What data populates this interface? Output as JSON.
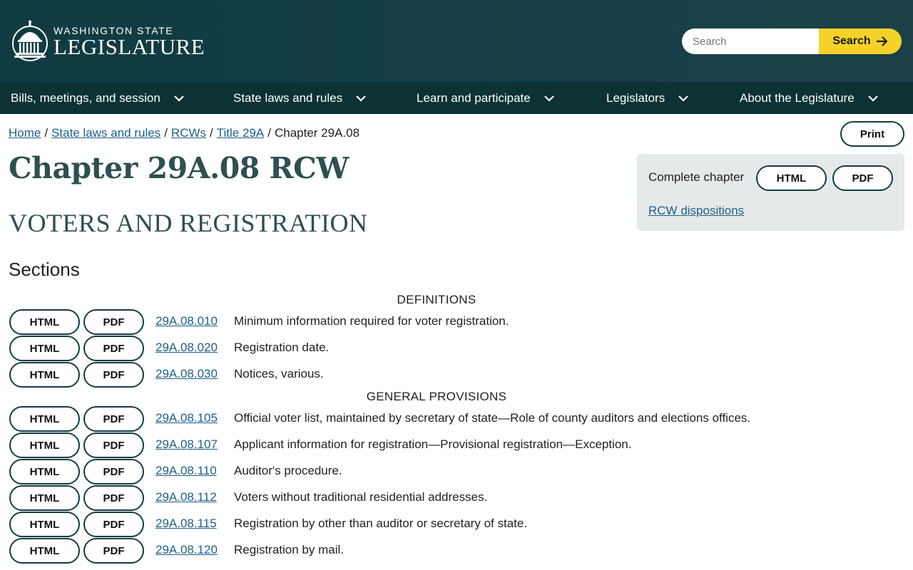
{
  "header": {
    "logo_line1": "WASHINGTON STATE",
    "logo_line2": "LEGISLATURE",
    "search_placeholder": "Search",
    "search_button": "Search"
  },
  "nav": [
    {
      "label": "Bills, meetings, and session"
    },
    {
      "label": "State laws and rules"
    },
    {
      "label": "Learn and participate"
    },
    {
      "label": "Legislators"
    },
    {
      "label": "About the Legislature"
    }
  ],
  "breadcrumb": {
    "items": [
      "Home",
      "State laws and rules",
      "RCWs",
      "Title 29A"
    ],
    "current": "Chapter 29A.08"
  },
  "print_label": "Print",
  "chapter": {
    "title": "Chapter 29A.08 RCW",
    "subtitle": "VOTERS AND REGISTRATION"
  },
  "side_panel": {
    "complete_label": "Complete chapter",
    "html_label": "HTML",
    "pdf_label": "PDF",
    "dispositions_link": "RCW dispositions"
  },
  "sections_heading": "Sections",
  "groups": [
    {
      "label": "DEFINITIONS",
      "sections": [
        {
          "number": "29A.08.010",
          "title": "Minimum information required for voter registration."
        },
        {
          "number": "29A.08.020",
          "title": "Registration date."
        },
        {
          "number": "29A.08.030",
          "title": "Notices, various."
        }
      ]
    },
    {
      "label": "GENERAL PROVISIONS",
      "sections": [
        {
          "number": "29A.08.105",
          "title": "Official voter list, maintained by secretary of state—Role of county auditors and elections offices."
        },
        {
          "number": "29A.08.107",
          "title": "Applicant information for registration—Provisional registration—Exception."
        },
        {
          "number": "29A.08.110",
          "title": "Auditor's procedure."
        },
        {
          "number": "29A.08.112",
          "title": "Voters without traditional residential addresses."
        },
        {
          "number": "29A.08.115",
          "title": "Registration by other than auditor or secretary of state."
        },
        {
          "number": "29A.08.120",
          "title": "Registration by mail."
        }
      ]
    }
  ],
  "row_buttons": {
    "html": "HTML",
    "pdf": "PDF"
  },
  "colors": {
    "header_bg": "#0f3b41",
    "nav_bg": "#0c3234",
    "search_button_bg": "#f6d229",
    "heading_color": "#2e4f50",
    "link_color": "#1d5f8a",
    "panel_bg": "#e6e9e9"
  },
  "icons": {
    "logo": "capitol-dome-icon",
    "search_arrow": "arrow-right-icon",
    "nav_chevron": "chevron-down-icon"
  }
}
